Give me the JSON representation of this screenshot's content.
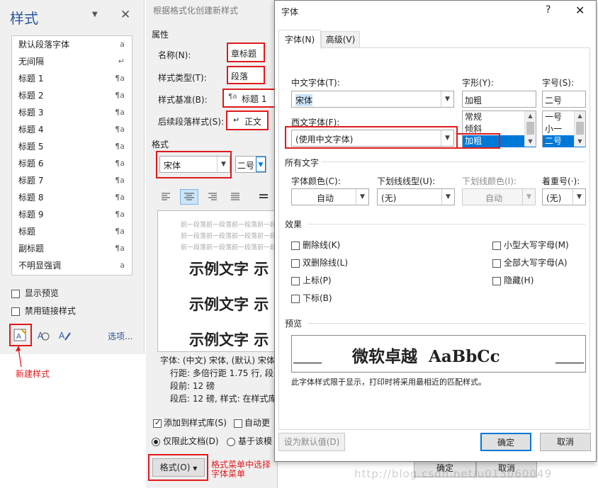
{
  "styles_pane": {
    "title": "样式",
    "items": [
      {
        "label": "默认段落字体",
        "mark": "a"
      },
      {
        "label": "无间隔",
        "mark": "↵"
      },
      {
        "label": "标题 1",
        "mark": "¶a"
      },
      {
        "label": "标题 2",
        "mark": "¶a"
      },
      {
        "label": "标题 3",
        "mark": "¶a"
      },
      {
        "label": "标题 4",
        "mark": "¶a"
      },
      {
        "label": "标题 5",
        "mark": "¶a"
      },
      {
        "label": "标题 6",
        "mark": "¶a"
      },
      {
        "label": "标题 7",
        "mark": "¶a"
      },
      {
        "label": "标题 8",
        "mark": "¶a"
      },
      {
        "label": "标题 9",
        "mark": "¶a"
      },
      {
        "label": "标题",
        "mark": "¶a"
      },
      {
        "label": "副标题",
        "mark": "¶a"
      },
      {
        "label": "不明显强调",
        "mark": "a"
      }
    ],
    "show_preview": "显示预览",
    "disable_linked": "禁用链接样式",
    "options_link": "选项...",
    "annotation": "新建样式"
  },
  "format_dialog": {
    "title": "根据格式化创建新样式",
    "properties": "属性",
    "name_label": "名称(N):",
    "name_value": "章标题",
    "type_label": "样式类型(T):",
    "type_value": "段落",
    "base_label": "样式基准(B):",
    "base_value": "标题 1",
    "next_label": "后续段落样式(S):",
    "next_value": "正文",
    "format_section": "格式",
    "font_value": "宋体",
    "size_value": "二号",
    "preview_prev": [
      "前一段落前一段落前一段落前一段落前",
      "前一段落前一段落前一段落前一段落前",
      "前一段落前一段落前一段落前一段落前"
    ],
    "sample_text": "示例文字 示",
    "desc_lines": [
      "字体: (中文) 宋体, (默认) 宋体",
      "行距: 多倍行距 1.75 行, 段",
      "段前: 12 磅",
      "段后: 12 磅, 样式: 在样式库"
    ],
    "add_to_gallery": "添加到样式库(S)",
    "auto_update": "自动更",
    "only_this_doc": "仅限此文档(D)",
    "based_on_template": "基于该模",
    "format_button": "格式(O)",
    "ok": "确定",
    "cancel": "取消",
    "annotation_lines": [
      "格式菜单中选择",
      "字体菜单"
    ]
  },
  "font_dialog": {
    "title": "字体",
    "help": "?",
    "tabs": [
      "字体(N)",
      "高级(V)"
    ],
    "cn_font_label": "中文字体(T):",
    "cn_font_value": "宋体",
    "style_label": "字形(Y):",
    "style_value": "加粗",
    "style_options": [
      "常规",
      "倾斜",
      "加粗"
    ],
    "size_label": "字号(S):",
    "size_value": "二号",
    "size_options": [
      "一号",
      "小一",
      "二号"
    ],
    "west_font_label": "西文字体(F):",
    "west_font_value": "(使用中文字体)",
    "all_text": "所有文字",
    "color_label": "字体颜色(C):",
    "color_value": "自动",
    "underline_label": "下划线线型(U):",
    "underline_value": "(无)",
    "underline_color_label": "下划线颜色(I):",
    "underline_color_value": "自动",
    "emphasis_label": "着重号(·):",
    "emphasis_value": "(无)",
    "effects": "效果",
    "effects_left": [
      "删除线(K)",
      "双删除线(L)",
      "上标(P)",
      "下标(B)"
    ],
    "effects_right": [
      "小型大写字母(M)",
      "全部大写字母(A)",
      "隐藏(H)"
    ],
    "preview_label": "预览",
    "preview_text": "微软卓越  AaBbCc",
    "preview_note": "此字体样式限于显示，打印时将采用最相近的匹配样式。",
    "set_default": "设为默认值(D)",
    "ok": "确定",
    "cancel": "取消"
  },
  "watermark": "http://blog.csdn.net/u013060049",
  "colors": {
    "accent": "#0078d7",
    "highlight": "#e0191b",
    "title_blue": "#2b579a"
  }
}
